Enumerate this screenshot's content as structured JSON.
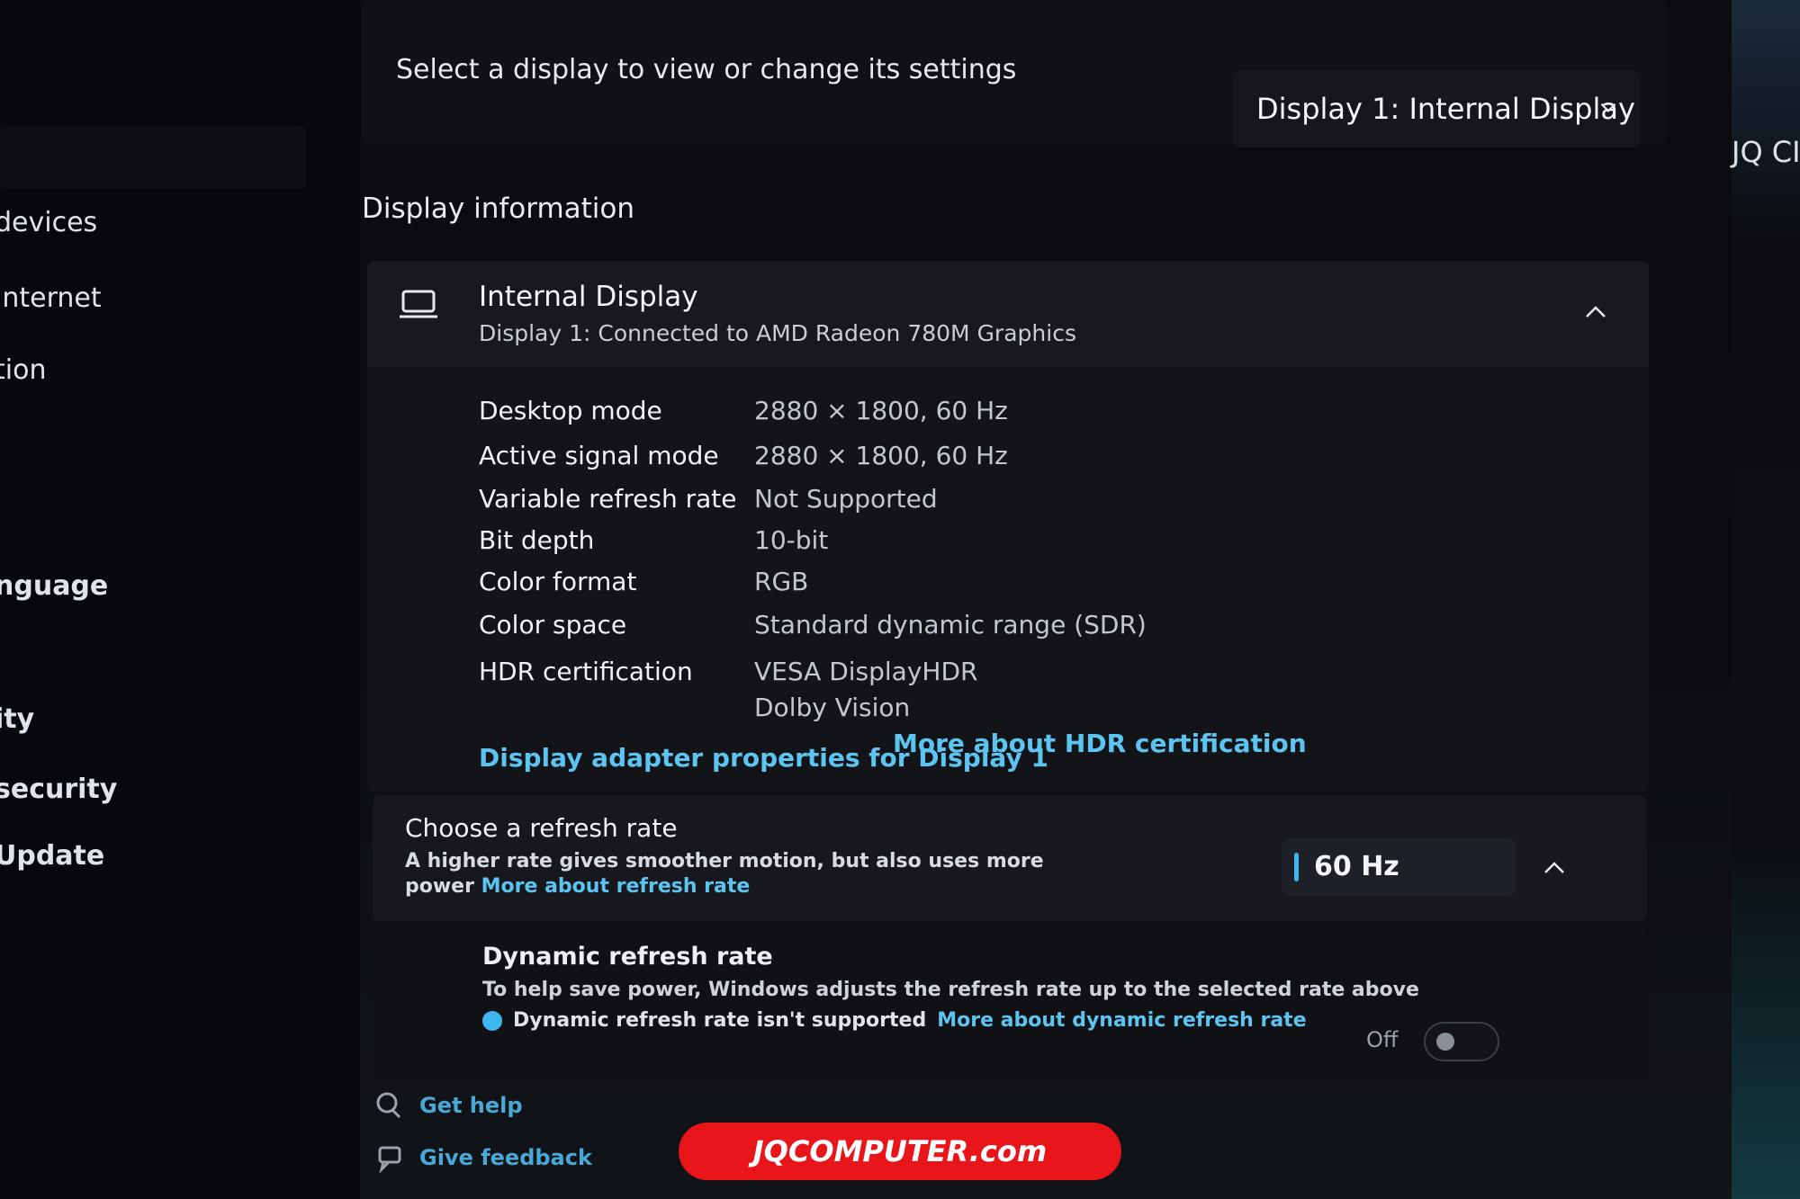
{
  "sidebar": {
    "items": [
      {
        "label": "devices",
        "bold": false
      },
      {
        "label": "internet",
        "bold": false
      },
      {
        "label": "tion",
        "bold": false
      },
      {
        "label": "nguage",
        "bold": true
      },
      {
        "label": "ity",
        "bold": true
      },
      {
        "label": "security",
        "bold": true
      },
      {
        "label": "Update",
        "bold": true
      }
    ]
  },
  "header": {
    "select_label": "Select a display to view or change its settings",
    "dropdown_value": "Display 1: Internal Display",
    "dropdown_icon": "chevron-down-icon"
  },
  "display_info": {
    "section_title": "Display information",
    "name": "Internal Display",
    "subtitle": "Display 1: Connected to AMD Radeon 780M Graphics",
    "properties": [
      {
        "label": "Desktop mode",
        "value": "2880 × 1800, 60 Hz"
      },
      {
        "label": "Active signal mode",
        "value": "2880 × 1800, 60 Hz"
      },
      {
        "label": "Variable refresh rate",
        "value": "Not Supported"
      },
      {
        "label": "Bit depth",
        "value": "10-bit"
      },
      {
        "label": "Color format",
        "value": "RGB"
      },
      {
        "label": "Color space",
        "value": "Standard dynamic range (SDR)"
      },
      {
        "label": "HDR certification",
        "value": "VESA DisplayHDR"
      }
    ],
    "hdr_extra": "Dolby Vision",
    "hdr_link": "More about HDR certification",
    "adapter_link": "Display adapter properties for Display 1"
  },
  "refresh": {
    "title": "Choose a refresh rate",
    "description": "A higher rate gives smoother motion, but also uses more power",
    "link": "More about refresh rate",
    "value": "60 Hz"
  },
  "dynamic_refresh": {
    "title": "Dynamic refresh rate",
    "description": "To help save power, Windows adjusts the refresh rate up to the selected rate above",
    "note": "Dynamic refresh rate isn't supported",
    "link": "More about dynamic refresh rate",
    "toggle_label": "Off",
    "toggle_on": false
  },
  "footer": {
    "get_help": "Get help",
    "give_feedback": "Give feedback"
  },
  "right_panel": {
    "partial_text": "JQ CI"
  },
  "watermark": "JQCOMPUTER.com",
  "colors": {
    "accent": "#5cc4f0",
    "background": "#0a0c10",
    "watermark_bg": "#e8151b"
  }
}
